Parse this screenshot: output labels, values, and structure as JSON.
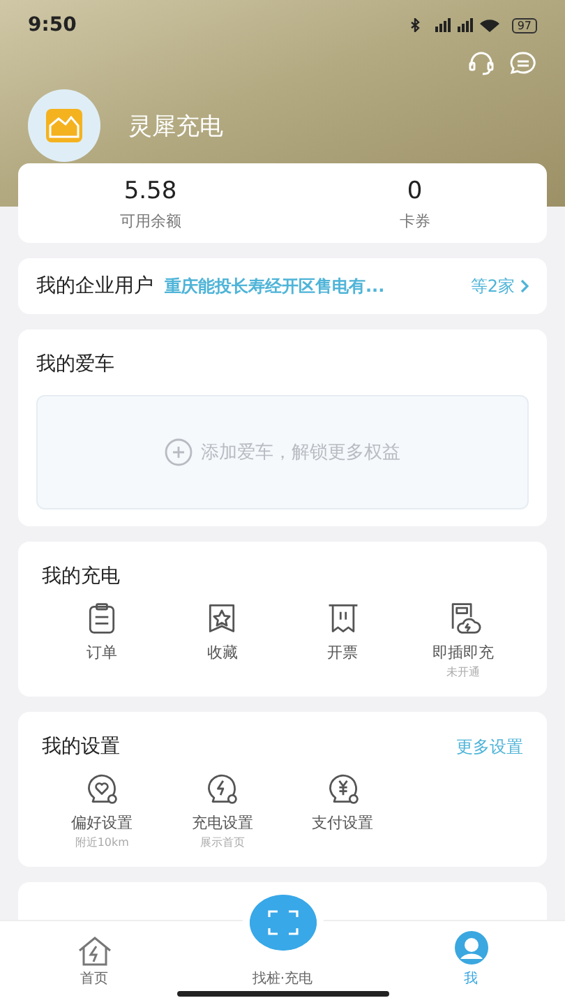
{
  "status_bar": {
    "time": "9:50",
    "battery": "97"
  },
  "profile": {
    "name": "灵犀充电"
  },
  "balance": [
    {
      "value": "5.58",
      "label": "可用余额"
    },
    {
      "value": "0",
      "label": "卡券"
    }
  ],
  "enterprise": {
    "title": "我的企业用户",
    "company": "重庆能投长寿经开区售电有...",
    "count": "等2家"
  },
  "car": {
    "title": "我的爱车",
    "add_text": "添加爱车，解锁更多权益"
  },
  "charging": {
    "title": "我的充电",
    "items": [
      {
        "kind": "order",
        "label": "订单"
      },
      {
        "kind": "favorite",
        "label": "收藏"
      },
      {
        "kind": "invoice",
        "label": "开票"
      },
      {
        "kind": "plug",
        "label": "即插即充",
        "sub": "未开通"
      }
    ]
  },
  "settings": {
    "title": "我的设置",
    "more": "更多设置",
    "items": [
      {
        "kind": "preference",
        "label": "偏好设置",
        "sub": "附近10km"
      },
      {
        "kind": "charge",
        "label": "充电设置",
        "sub": "展示首页"
      },
      {
        "kind": "payment",
        "label": "支付设置"
      }
    ]
  },
  "tab_bar": [
    {
      "kind": "home",
      "label": "首页",
      "selected": false
    },
    {
      "kind": "scan",
      "label": "找桩·充电",
      "selected": false
    },
    {
      "kind": "me",
      "label": "我",
      "selected": true
    }
  ]
}
